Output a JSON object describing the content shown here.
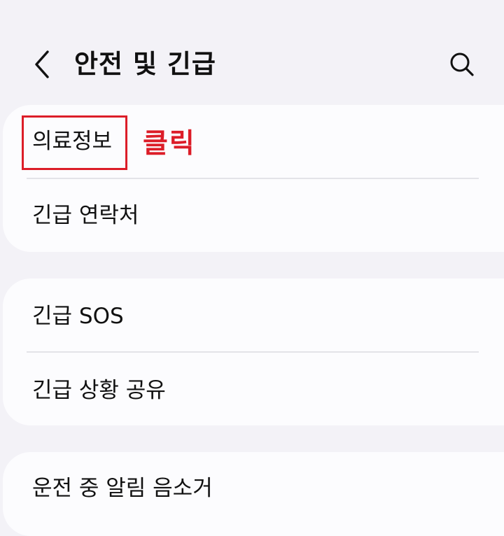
{
  "header": {
    "title": "안전 및 긴급",
    "back_icon": "chevron-left-icon",
    "search_icon": "search-icon"
  },
  "sections": [
    {
      "items": [
        {
          "label": "의료정보"
        },
        {
          "label": "긴급 연락처"
        }
      ]
    },
    {
      "items": [
        {
          "label": "긴급 SOS"
        },
        {
          "label": "긴급 상황 공유"
        }
      ]
    },
    {
      "items": [
        {
          "label": "운전 중 알림 음소거"
        }
      ]
    }
  ],
  "annotation": {
    "text": "클릭",
    "color": "#dc1d28"
  },
  "colors": {
    "background": "#f3f2f7",
    "card": "#fcfcfe",
    "divider": "#e3e3e8",
    "text": "#111111"
  }
}
